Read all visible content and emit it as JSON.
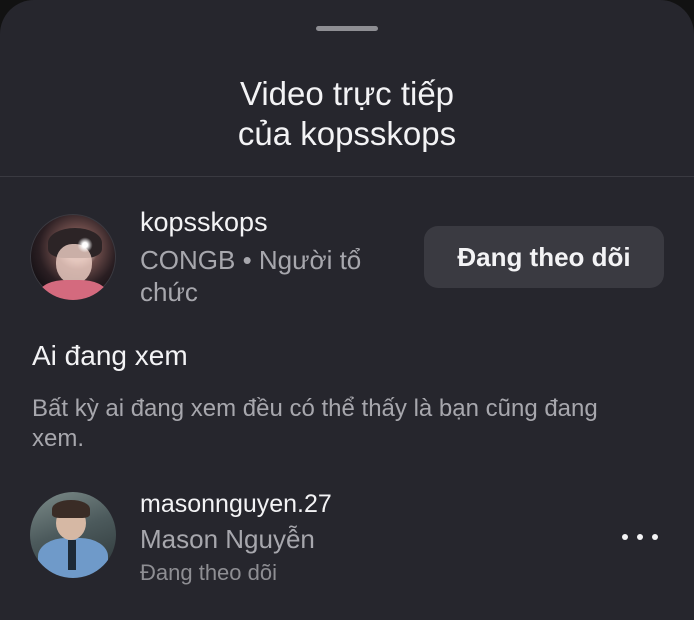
{
  "header": {
    "title_line1": "Video trực tiếp",
    "title_line2": "của kopsskops"
  },
  "host": {
    "username": "kopsskops",
    "subtitle": "CONGB • Người tổ chức",
    "follow_label": "Đang theo dõi"
  },
  "viewers_section": {
    "title": "Ai đang xem",
    "description": "Bất kỳ ai đang xem đều có thể thấy là bạn cũng đang xem."
  },
  "viewers": [
    {
      "username": "masonnguyen.27",
      "name": "Mason Nguyễn",
      "status": "Đang theo dõi"
    }
  ],
  "icons": {
    "more": "more-horizontal-icon"
  },
  "colors": {
    "sheet_background": "#26262d",
    "primary_text": "#f3f3f5",
    "secondary_text": "#a7a7ad",
    "button_background": "#3a3a41"
  }
}
